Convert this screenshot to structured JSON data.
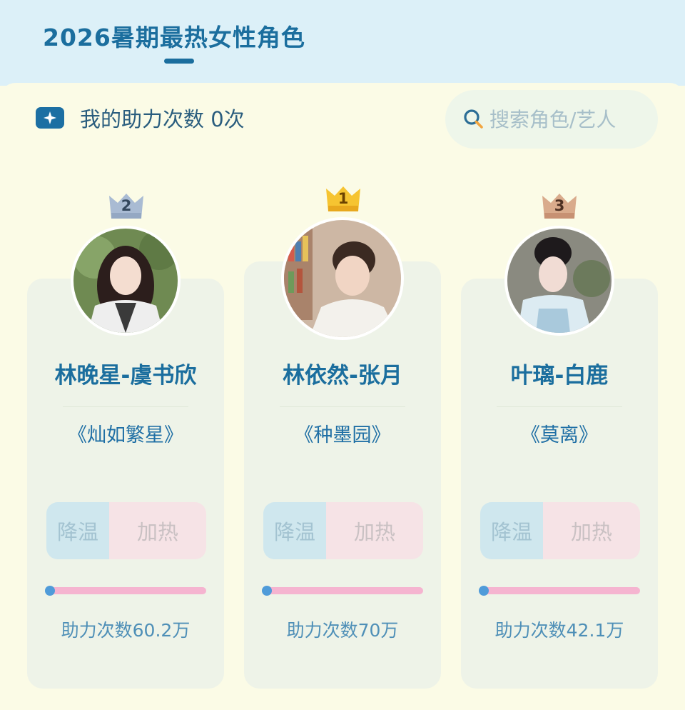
{
  "header": {
    "title": "2026暑期最热女性角色"
  },
  "boost": {
    "label": "我的助力次数 0次",
    "icon": "sparkle-icon"
  },
  "search": {
    "placeholder": "搜索角色/艺人",
    "icon": "search-icon"
  },
  "buttons": {
    "cool": "降温",
    "heat": "加热"
  },
  "colors": {
    "accent": "#1b6e9e",
    "header_bg": "#dcf0f8",
    "page_bg": "#fbfbe6",
    "card_bg": "#eef3e8",
    "progress_fill": "#f5b4d0",
    "progress_dot": "#4f9bd9",
    "crown_gold": "#f3b92a",
    "crown_silver": "#a9bbd3",
    "crown_bronze": "#d3a586"
  },
  "cards": [
    {
      "rank": "2",
      "crown": "silver-crown-icon",
      "name": "林晚星-虞书欣",
      "work": "《灿如繁星》",
      "count": "助力次数60.2万",
      "avatar": "avatar-photo"
    },
    {
      "rank": "1",
      "crown": "gold-crown-icon",
      "name": "林依然-张月",
      "work": "《种墨园》",
      "count": "助力次数70万",
      "avatar": "avatar-photo"
    },
    {
      "rank": "3",
      "crown": "bronze-crown-icon",
      "name": "叶璃-白鹿",
      "work": "《莫离》",
      "count": "助力次数42.1万",
      "avatar": "avatar-photo"
    }
  ]
}
